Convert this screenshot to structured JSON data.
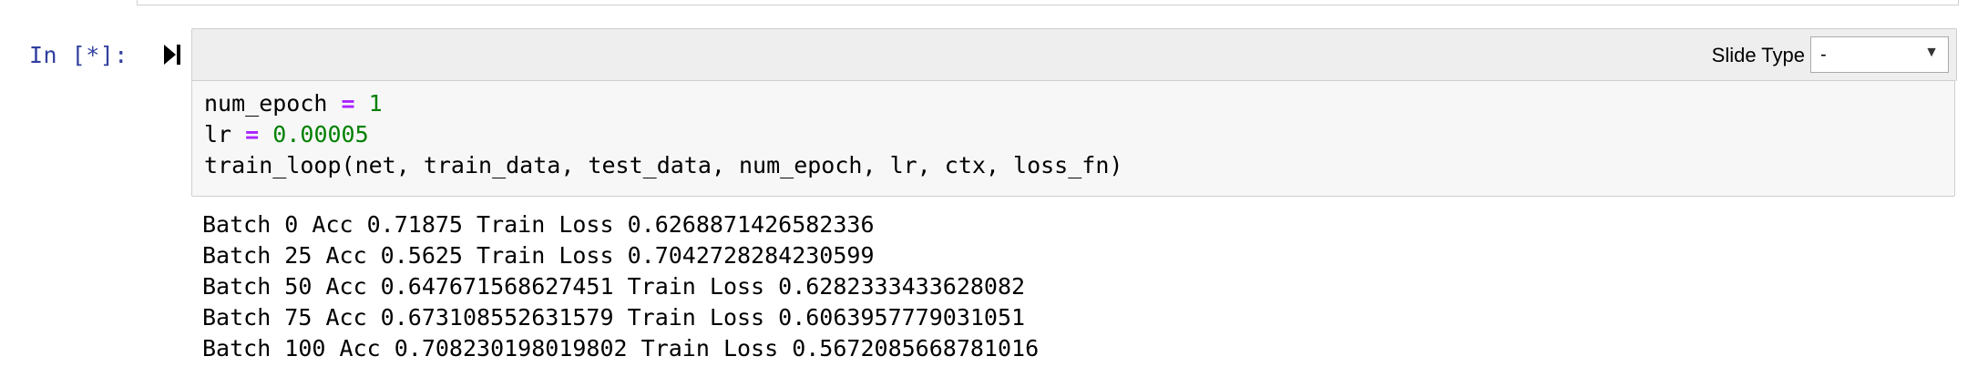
{
  "cell": {
    "prompt": "In [*]:",
    "run_icon": "run-cell-icon",
    "toolbar": {
      "slide_type_label": "Slide Type",
      "slide_type_value": "-",
      "dropdown_icon": "triangle-down"
    },
    "code": {
      "line1": {
        "var": "num_epoch",
        "op": "=",
        "value": "1"
      },
      "line2": {
        "var": "lr",
        "op": "=",
        "value": "0.00005"
      },
      "line3": "train_loop(net, train_data, test_data, num_epoch, lr, ctx, loss_fn)"
    },
    "output": [
      "Batch 0 Acc 0.71875 Train Loss 0.6268871426582336",
      "Batch 25 Acc 0.5625 Train Loss 0.7042728284230599",
      "Batch 50 Acc 0.647671568627451 Train Loss 0.6282333433628082",
      "Batch 75 Acc 0.673108552631579 Train Loss 0.6063957779031051",
      "Batch 100 Acc 0.708230198019802 Train Loss 0.5672085668781016"
    ]
  },
  "colors": {
    "prompt": "#303f9f",
    "operator": "#aa22ff",
    "number": "#008000",
    "code_bg": "#f7f7f7",
    "toolbar_bg": "#eeeeee",
    "border": "#cfcfcf"
  }
}
